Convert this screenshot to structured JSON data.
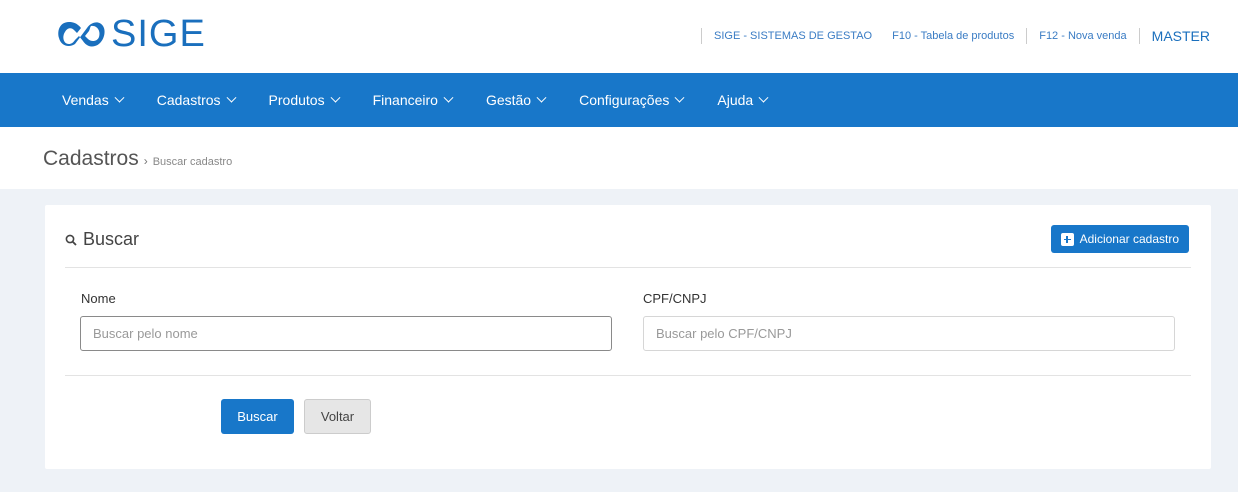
{
  "brand": {
    "name": "SIGE",
    "accent": "#1877c9"
  },
  "toplinks": {
    "company": "SIGE - SISTEMAS DE GESTAO",
    "f10": "F10 - Tabela de produtos",
    "f12": "F12 - Nova venda",
    "user": "MASTER"
  },
  "nav": {
    "items": [
      {
        "label": "Vendas"
      },
      {
        "label": "Cadastros"
      },
      {
        "label": "Produtos"
      },
      {
        "label": "Financeiro"
      },
      {
        "label": "Gestão"
      },
      {
        "label": "Configurações"
      },
      {
        "label": "Ajuda"
      }
    ]
  },
  "breadcrumb": {
    "section": "Cadastros",
    "separator": "›",
    "page": "Buscar cadastro"
  },
  "panel": {
    "title": "Buscar",
    "add_button": "Adicionar cadastro",
    "fields": {
      "nome": {
        "label": "Nome",
        "placeholder": "Buscar pelo nome",
        "value": ""
      },
      "cpf": {
        "label": "CPF/CNPJ",
        "placeholder": "Buscar pelo CPF/CNPJ",
        "value": ""
      }
    },
    "buttons": {
      "search": "Buscar",
      "back": "Voltar"
    }
  }
}
